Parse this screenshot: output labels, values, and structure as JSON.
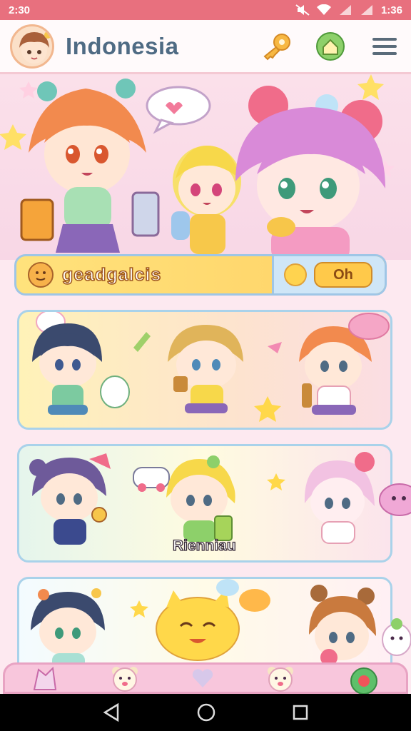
{
  "status_bar": {
    "time": "2:30",
    "clock": "1:36"
  },
  "app_bar": {
    "title": "Indonesia"
  },
  "scorebar": {
    "label": "geadgalcis",
    "action_label": "Oh"
  },
  "cards": [
    {
      "caption": ""
    },
    {
      "caption": "Rienniau"
    },
    {
      "caption": ""
    }
  ],
  "colors": {
    "status_bar": "#e8707e",
    "title": "#4f6b84",
    "accent": "#ffd266",
    "card_border": "#a9d2ea"
  }
}
